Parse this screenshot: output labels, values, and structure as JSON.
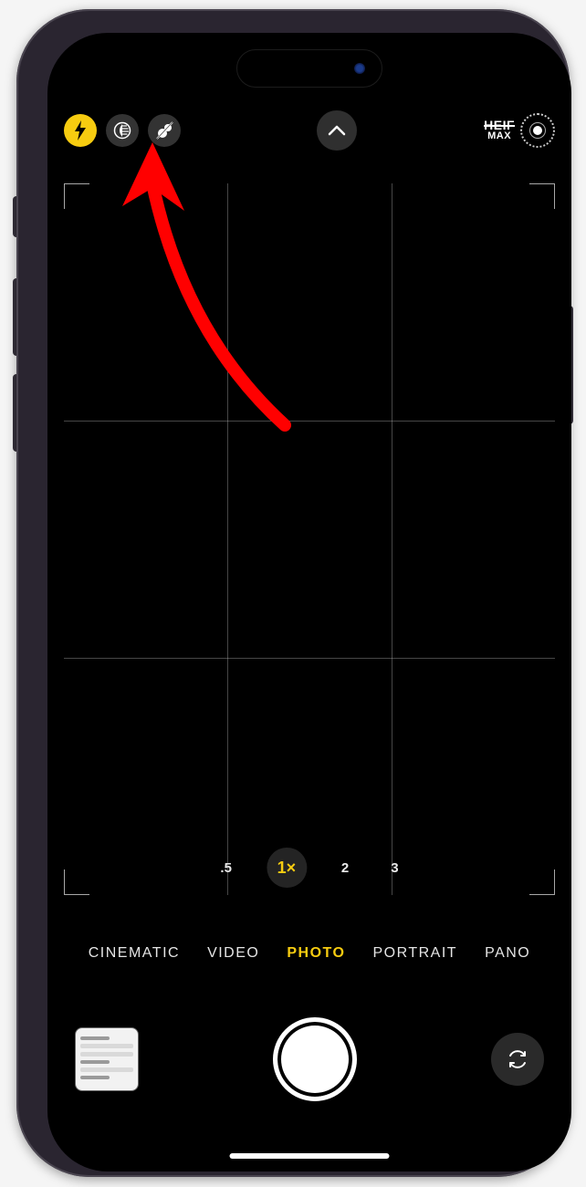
{
  "format_badge": {
    "line1": "HEIF",
    "line2": "MAX"
  },
  "zoom": {
    "options": [
      ".5",
      "1×",
      "2",
      "3"
    ],
    "active_index": 1
  },
  "modes": {
    "items": [
      "CINEMATIC",
      "VIDEO",
      "PHOTO",
      "PORTRAIT",
      "PANO"
    ],
    "active_index": 2
  },
  "icons": {
    "flash": "flash-icon",
    "night": "night-mode-icon",
    "live_off": "live-photo-off-icon",
    "chevron": "chevron-up-icon",
    "raw_target": "photographic-styles-icon",
    "flip": "camera-flip-icon"
  },
  "annotation": {
    "color": "#ff0000",
    "target": "night-mode-button"
  }
}
